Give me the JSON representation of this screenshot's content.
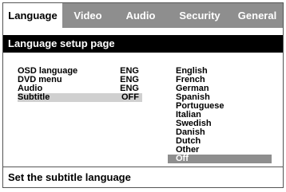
{
  "tabs": [
    {
      "label": "Language"
    },
    {
      "label": "Video"
    },
    {
      "label": "Audio"
    },
    {
      "label": "Security"
    },
    {
      "label": "General"
    }
  ],
  "section_title": "Language setup page",
  "settings": [
    {
      "label": "OSD language",
      "value": "ENG"
    },
    {
      "label": "DVD menu",
      "value": "ENG"
    },
    {
      "label": "Audio",
      "value": "ENG"
    },
    {
      "label": "Subtitle",
      "value": "OFF"
    }
  ],
  "options": [
    "English",
    "French",
    "German",
    "Spanish",
    "Portuguese",
    "Italian",
    "Swedish",
    "Danish",
    "Dutch",
    "Other",
    "Off"
  ],
  "status_text": "Set the subtitle language",
  "colors": {
    "tab_bar": "#8e8e8e",
    "section_bar": "#000000",
    "selected_row": "#d0d0d0",
    "selected_option": "#8e8e8e"
  }
}
